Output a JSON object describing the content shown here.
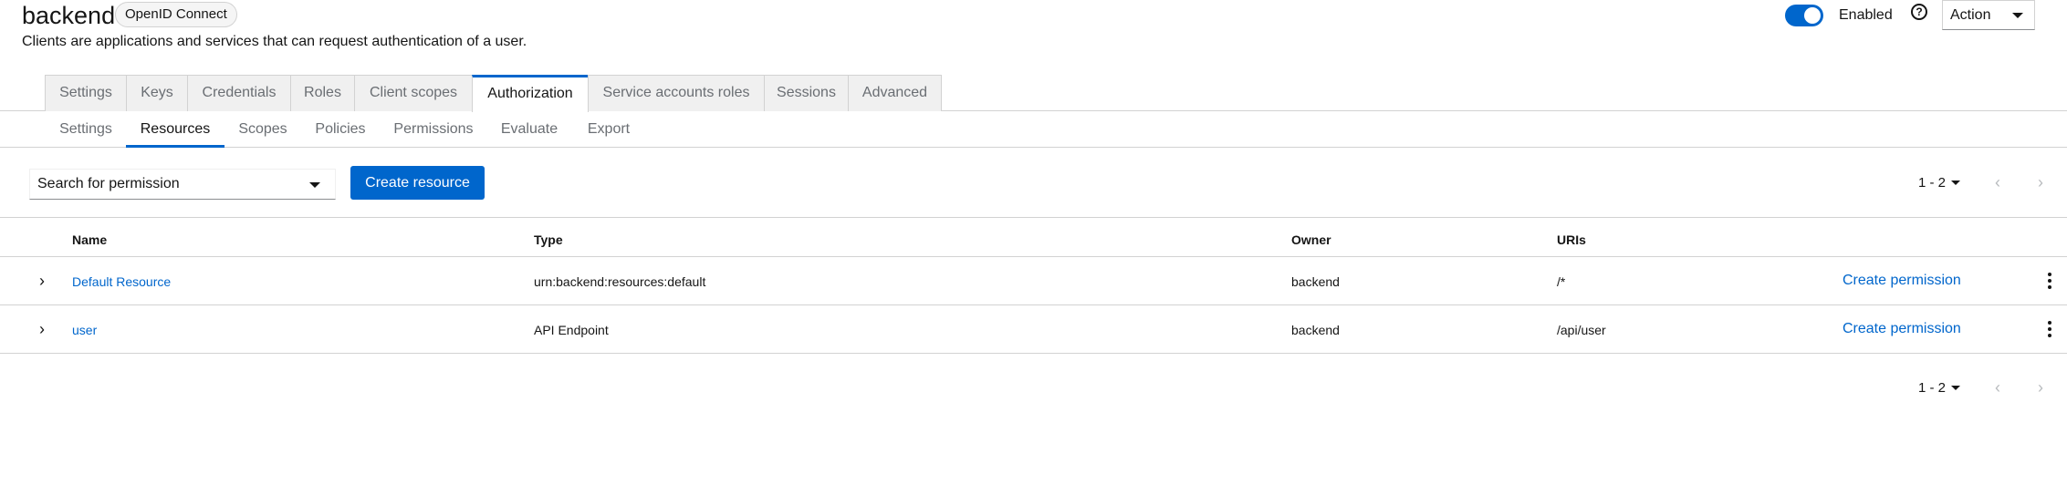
{
  "header": {
    "title": "backend",
    "badge": "OpenID Connect",
    "subtitle": "Clients are applications and services that can request authentication of a user.",
    "enabled_label": "Enabled",
    "enabled": true,
    "help_icon": "?",
    "action_label": "Action"
  },
  "tabs": [
    {
      "label": "Settings"
    },
    {
      "label": "Keys"
    },
    {
      "label": "Credentials"
    },
    {
      "label": "Roles"
    },
    {
      "label": "Client scopes"
    },
    {
      "label": "Authorization",
      "active": true
    },
    {
      "label": "Service accounts roles"
    },
    {
      "label": "Sessions"
    },
    {
      "label": "Advanced"
    }
  ],
  "subtabs": [
    {
      "label": "Settings"
    },
    {
      "label": "Resources",
      "active": true
    },
    {
      "label": "Scopes"
    },
    {
      "label": "Policies"
    },
    {
      "label": "Permissions"
    },
    {
      "label": "Evaluate"
    },
    {
      "label": "Export"
    }
  ],
  "toolbar": {
    "search_label": "Search for permission",
    "create_label": "Create resource",
    "pagination": "1 - 2",
    "prev_icon": "‹",
    "next_icon": "›"
  },
  "table": {
    "columns": [
      "Name",
      "Type",
      "Owner",
      "URIs"
    ],
    "rows": [
      {
        "expand_icon": "›",
        "name": "Default Resource",
        "type": "urn:backend:resources:default",
        "owner": "backend",
        "uris": "/*",
        "action": "Create permission"
      },
      {
        "expand_icon": "›",
        "name": "user",
        "type": "API Endpoint",
        "owner": "backend",
        "uris": "/api/user",
        "action": "Create permission"
      }
    ]
  },
  "footer": {
    "pagination": "1 - 2",
    "prev_icon": "‹",
    "next_icon": "›"
  },
  "colors": {
    "accent": "#0066cc",
    "border": "#d2d2d2",
    "muted_text": "#6a6e73"
  }
}
